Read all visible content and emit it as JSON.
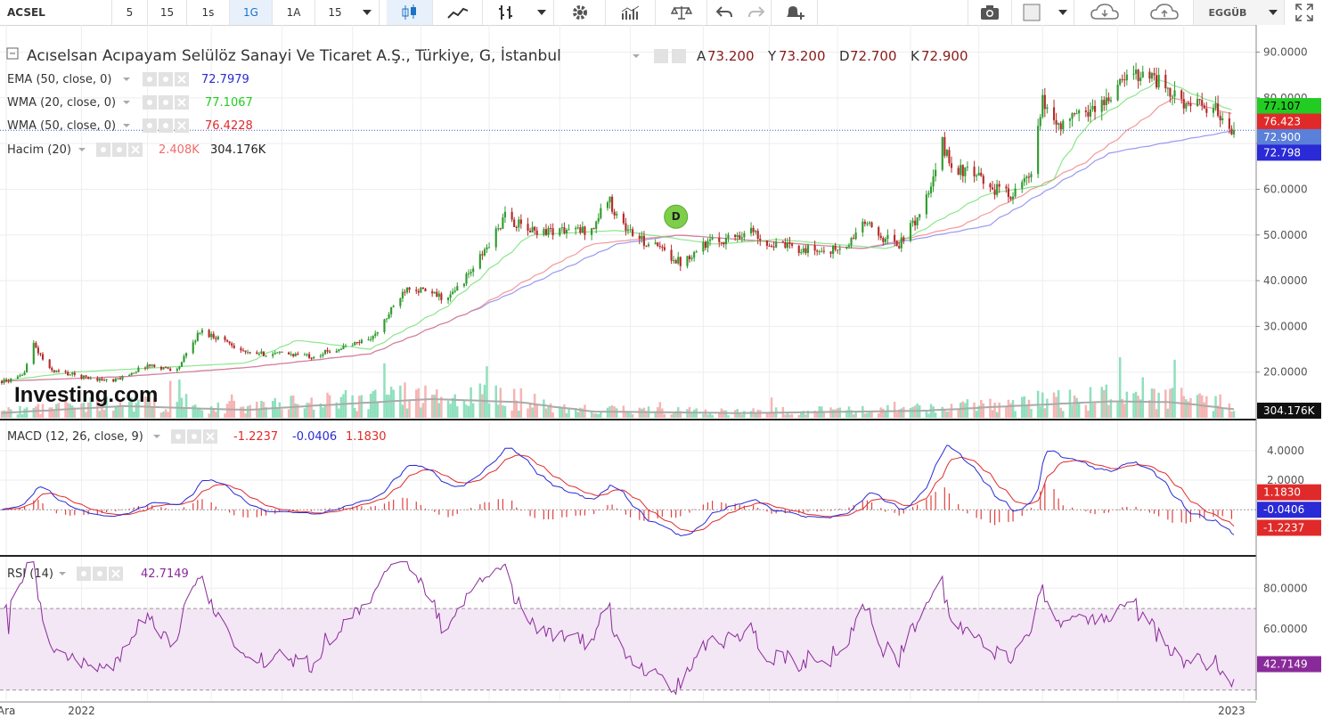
{
  "toolbar": {
    "symbol": "ACSEL",
    "timeframes": [
      "5",
      "15",
      "1s",
      "1G",
      "1A",
      "15"
    ],
    "active_timeframe": "1G",
    "user": "EGGÜB",
    "icons": [
      "chevron-down-icon",
      "candlestick-icon",
      "line-chart-icon",
      "bar-chart-icon",
      "chevron-down-icon",
      "gear-icon",
      "volume-bars-icon",
      "scale-icon",
      "undo-icon",
      "redo-icon",
      "add-alert-icon",
      "camera-icon",
      "square-icon",
      "chevron-down-icon",
      "cloud-download-icon",
      "cloud-upload-icon",
      "chevron-down-icon",
      "fullscreen-icon"
    ]
  },
  "chart_data": [
    {
      "type": "candlestick",
      "title": "Acıselsan Acıpayam Selülöz Sanayi Ve Ticaret A.Ş., Türkiye, G, İstanbul",
      "ohlc_labels": {
        "A": "73.200",
        "Y": "73.200",
        "D": "72.700",
        "K": "72.900"
      },
      "indicators": [
        {
          "name": "EMA (50, close, 0)",
          "value": "72.7979",
          "color": "#2a2ad6",
          "axis_label": "72.798"
        },
        {
          "name": "WMA (20, close, 0)",
          "value": "77.1067",
          "color": "#22cc22",
          "axis_label": "77.107"
        },
        {
          "name": "WMA (50, close, 0)",
          "value": "76.4228",
          "color": "#e02a2a",
          "axis_label": "76.423"
        },
        {
          "name": "Hacim (20)",
          "value": "2.408K",
          "value2": "304.176K",
          "color": "#f26b6b",
          "axis_label": "304.176K"
        }
      ],
      "last_price_label": "72.900",
      "ylim": [
        10,
        94
      ],
      "yticks": [
        "90.0000",
        "80.0000",
        "70.0000",
        "60.0000",
        "50.0000",
        "40.0000",
        "30.0000",
        "20.0000"
      ],
      "price_anchors": [
        [
          "2021-12-01",
          18
        ],
        [
          "2021-12-08",
          19
        ],
        [
          "2021-12-13",
          26
        ],
        [
          "2021-12-20",
          20.5
        ],
        [
          "2022-01-03",
          19
        ],
        [
          "2022-01-17",
          18
        ],
        [
          "2022-02-01",
          21.5
        ],
        [
          "2022-02-14",
          20.5
        ],
        [
          "2022-02-24",
          29
        ],
        [
          "2022-03-07",
          27
        ],
        [
          "2022-03-17",
          24
        ],
        [
          "2022-04-04",
          24
        ],
        [
          "2022-04-14",
          23.5
        ],
        [
          "2022-05-02",
          26
        ],
        [
          "2022-05-12",
          28
        ],
        [
          "2022-05-26",
          39
        ],
        [
          "2022-06-06",
          37
        ],
        [
          "2022-06-13",
          36
        ],
        [
          "2022-06-23",
          42
        ],
        [
          "2022-07-01",
          48
        ],
        [
          "2022-07-08",
          54
        ],
        [
          "2022-07-18",
          51
        ],
        [
          "2022-08-01",
          51
        ],
        [
          "2022-08-15",
          51
        ],
        [
          "2022-08-22",
          58
        ],
        [
          "2022-08-29",
          52
        ],
        [
          "2022-09-05",
          49
        ],
        [
          "2022-09-14",
          47
        ],
        [
          "2022-09-23",
          44
        ],
        [
          "2022-10-03",
          48
        ],
        [
          "2022-10-12",
          49
        ],
        [
          "2022-10-24",
          51
        ],
        [
          "2022-11-01",
          48
        ],
        [
          "2022-11-14",
          47
        ],
        [
          "2022-11-23",
          46.5
        ],
        [
          "2022-12-05",
          47
        ],
        [
          "2022-12-12",
          53
        ],
        [
          "2022-12-19",
          50
        ],
        [
          "2022-12-28",
          48
        ],
        [
          "2023-01-04",
          53
        ],
        [
          "2023-01-11",
          60
        ],
        [
          "2023-01-16",
          70
        ],
        [
          "2023-01-20",
          65
        ],
        [
          "2023-01-30",
          63
        ],
        [
          "2023-02-08",
          60
        ],
        [
          "2023-02-16",
          59
        ],
        [
          "2023-02-24",
          63
        ],
        [
          "2023-03-01",
          79
        ],
        [
          "2023-03-08",
          74
        ],
        [
          "2023-03-20",
          77
        ],
        [
          "2023-03-28",
          79
        ],
        [
          "2023-04-06",
          84
        ],
        [
          "2023-04-14",
          86
        ],
        [
          "2023-04-20",
          84
        ],
        [
          "2023-04-28",
          80
        ],
        [
          "2023-05-09",
          78
        ],
        [
          "2023-05-17",
          77
        ],
        [
          "2023-05-24",
          72.9
        ]
      ],
      "ema50_anchors": [
        [
          0,
          18
        ],
        [
          0.1,
          19
        ],
        [
          0.2,
          21
        ],
        [
          0.3,
          24
        ],
        [
          0.38,
          33
        ],
        [
          0.5,
          48
        ],
        [
          0.55,
          50
        ],
        [
          0.7,
          47
        ],
        [
          0.8,
          52
        ],
        [
          0.9,
          68
        ],
        [
          1,
          72.8
        ]
      ],
      "wma20_anchors": [
        [
          0,
          18
        ],
        [
          0.06,
          20
        ],
        [
          0.2,
          22
        ],
        [
          0.24,
          27
        ],
        [
          0.3,
          25
        ],
        [
          0.36,
          34
        ],
        [
          0.43,
          50
        ],
        [
          0.5,
          51
        ],
        [
          0.58,
          48
        ],
        [
          0.63,
          49
        ],
        [
          0.72,
          47
        ],
        [
          0.76,
          53
        ],
        [
          0.8,
          59
        ],
        [
          0.85,
          61
        ],
        [
          0.88,
          74
        ],
        [
          0.94,
          84
        ],
        [
          1,
          77.1
        ]
      ],
      "wma50_anchors": [
        [
          0,
          18
        ],
        [
          0.1,
          19
        ],
        [
          0.2,
          21
        ],
        [
          0.3,
          24
        ],
        [
          0.38,
          33
        ],
        [
          0.48,
          48
        ],
        [
          0.55,
          50
        ],
        [
          0.7,
          47
        ],
        [
          0.78,
          52
        ],
        [
          0.88,
          66
        ],
        [
          0.95,
          80
        ],
        [
          1,
          76.4
        ]
      ],
      "volume_ma_anchors": [
        [
          0,
          60
        ],
        [
          0.1,
          150
        ],
        [
          0.2,
          100
        ],
        [
          0.25,
          150
        ],
        [
          0.35,
          240
        ],
        [
          0.42,
          200
        ],
        [
          0.48,
          80
        ],
        [
          0.6,
          60
        ],
        [
          0.75,
          90
        ],
        [
          0.82,
          150
        ],
        [
          0.9,
          210
        ],
        [
          0.95,
          200
        ],
        [
          1,
          110
        ]
      ]
    },
    {
      "type": "line",
      "name": "MACD (12, 26, close, 9)",
      "values": {
        "hist": "-1.2237",
        "macd": "-0.0406",
        "signal": "1.1830"
      },
      "axis_labels": [
        "1.1830",
        "-0.0406",
        "-1.2237"
      ],
      "colors": {
        "macd": "#2a2ad6",
        "signal": "#e02a2a",
        "hist": "#e02a2a"
      },
      "ylim": [
        -3.0,
        5.5
      ],
      "yticks": [
        "4.0000",
        "2.0000"
      ]
    },
    {
      "type": "line",
      "name": "RSI (14)",
      "value": "42.7149",
      "color": "#8a2a9a",
      "band": [
        30,
        70
      ],
      "ylim": [
        25,
        95
      ],
      "yticks": [
        "80.0000",
        "60.0000"
      ]
    }
  ],
  "x_axis": {
    "range": [
      "2021-11-29",
      "2023-05-24"
    ],
    "labels": [
      {
        "date": "2021-12-01",
        "text": "Ara"
      },
      {
        "date": "2022-01-03",
        "text": "2022"
      },
      {
        "date": "2023-05-23",
        "text": "2023"
      }
    ],
    "gridlines": [
      "2021-12-01",
      "2022-01-03",
      "2022-02-01",
      "2022-03-01",
      "2022-04-01",
      "2022-05-02",
      "2022-06-01",
      "2022-07-01",
      "2022-08-01",
      "2022-09-01",
      "2022-10-03",
      "2022-11-01",
      "2022-12-01",
      "2023-01-02",
      "2023-02-01",
      "2023-03-01",
      "2023-04-03",
      "2023-05-02"
    ]
  },
  "watermark": "Investing.com",
  "event_marker": "D"
}
